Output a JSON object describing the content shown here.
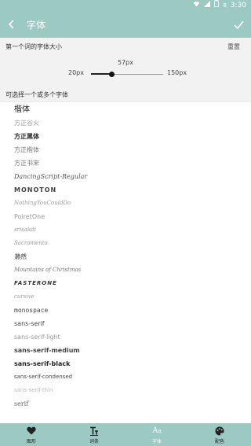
{
  "status_bar": {
    "time": "3:30",
    "battery_level": "8"
  },
  "app_bar": {
    "title": "字体"
  },
  "size_panel": {
    "label": "第一个词的字体大小",
    "reset_label": "重置",
    "value_label": "57px",
    "min_label": "20px",
    "max_label": "150px",
    "value": 57,
    "min": 20,
    "max": 150
  },
  "font_panel": {
    "header": "可选择一个或多个字体",
    "fonts": [
      {
        "name": "楷体",
        "size": 10,
        "weight": 400,
        "style": "normal",
        "color": "#222222",
        "family": "serif",
        "spacing": 0
      },
      {
        "name": "方正谷火",
        "size": 8,
        "weight": 400,
        "style": "normal",
        "color": "#999999",
        "family": "sans",
        "spacing": 0
      },
      {
        "name": "方正黑体",
        "size": 8,
        "weight": 600,
        "style": "normal",
        "color": "#222222",
        "family": "sans",
        "spacing": 0
      },
      {
        "name": "方正楷体",
        "size": 8,
        "weight": 400,
        "style": "normal",
        "color": "#777777",
        "family": "serif",
        "spacing": 0
      },
      {
        "name": "方正书宋",
        "size": 8,
        "weight": 400,
        "style": "normal",
        "color": "#777777",
        "family": "serif",
        "spacing": 0
      },
      {
        "name": "DancingScript-Regular",
        "size": 8,
        "weight": 400,
        "style": "italic",
        "color": "#555555",
        "family": "serif",
        "spacing": 0
      },
      {
        "name": "MONOTON",
        "size": 8,
        "weight": 800,
        "style": "normal",
        "color": "#444444",
        "family": "sans",
        "spacing": 1
      },
      {
        "name": "NothingYouCouldDo",
        "size": 7,
        "weight": 400,
        "style": "italic",
        "color": "#999999",
        "family": "serif",
        "spacing": 0
      },
      {
        "name": "PoiretOne",
        "size": 8,
        "weight": 400,
        "style": "normal",
        "color": "#999999",
        "family": "sans",
        "spacing": 0
      },
      {
        "name": "srisakdi",
        "size": 7,
        "weight": 400,
        "style": "italic",
        "color": "#999999",
        "family": "serif",
        "spacing": 0
      },
      {
        "name": "Sacramento",
        "size": 7,
        "weight": 400,
        "style": "italic",
        "color": "#999999",
        "family": "serif",
        "spacing": 0
      },
      {
        "name": "濑然",
        "size": 8,
        "weight": 400,
        "style": "normal",
        "color": "#333333",
        "family": "sans",
        "spacing": 0
      },
      {
        "name": "Mountains of Christmas",
        "size": 7,
        "weight": 400,
        "style": "italic",
        "color": "#777777",
        "family": "serif",
        "spacing": 0
      },
      {
        "name": "FASTERONE",
        "size": 7,
        "weight": 800,
        "style": "italic",
        "color": "#333333",
        "family": "sans",
        "spacing": 1
      },
      {
        "name": "cursive",
        "size": 7,
        "weight": 400,
        "style": "italic",
        "color": "#999999",
        "family": "serif",
        "spacing": 0
      },
      {
        "name": "monospace",
        "size": 8,
        "weight": 400,
        "style": "normal",
        "color": "#444444",
        "family": "mono",
        "spacing": 0
      },
      {
        "name": "sans-serif",
        "size": 8,
        "weight": 400,
        "style": "normal",
        "color": "#444444",
        "family": "sans",
        "spacing": 0
      },
      {
        "name": "sans-serif-light",
        "size": 8,
        "weight": 400,
        "style": "normal",
        "color": "#999999",
        "family": "sans",
        "spacing": 0
      },
      {
        "name": "sans-serif-medium",
        "size": 8,
        "weight": 600,
        "style": "normal",
        "color": "#444444",
        "family": "sans",
        "spacing": 0
      },
      {
        "name": "sans-serif-black",
        "size": 8,
        "weight": 800,
        "style": "normal",
        "color": "#222222",
        "family": "sans",
        "spacing": 0
      },
      {
        "name": "sans-serif-condensed",
        "size": 7,
        "weight": 400,
        "style": "normal",
        "color": "#444444",
        "family": "sans",
        "spacing": 0
      },
      {
        "name": "sans-serif-thin",
        "size": 7,
        "weight": 400,
        "style": "normal",
        "color": "#bbbbbb",
        "family": "sans",
        "spacing": 0
      },
      {
        "name": "serif",
        "size": 8,
        "weight": 400,
        "style": "normal",
        "color": "#444444",
        "family": "serif",
        "spacing": 0
      }
    ]
  },
  "bottom_nav": {
    "items": [
      {
        "label": "图形",
        "icon": "heart-icon",
        "active": false
      },
      {
        "label": "词条",
        "icon": "text-size-icon",
        "active": false
      },
      {
        "label": "字体",
        "icon": "font-icon",
        "active": true
      },
      {
        "label": "配色",
        "icon": "palette-icon",
        "active": false
      }
    ]
  },
  "colors": {
    "accent": "#9cc9c1",
    "panel": "#f2f2f2",
    "active_nav": "#ffffff"
  }
}
